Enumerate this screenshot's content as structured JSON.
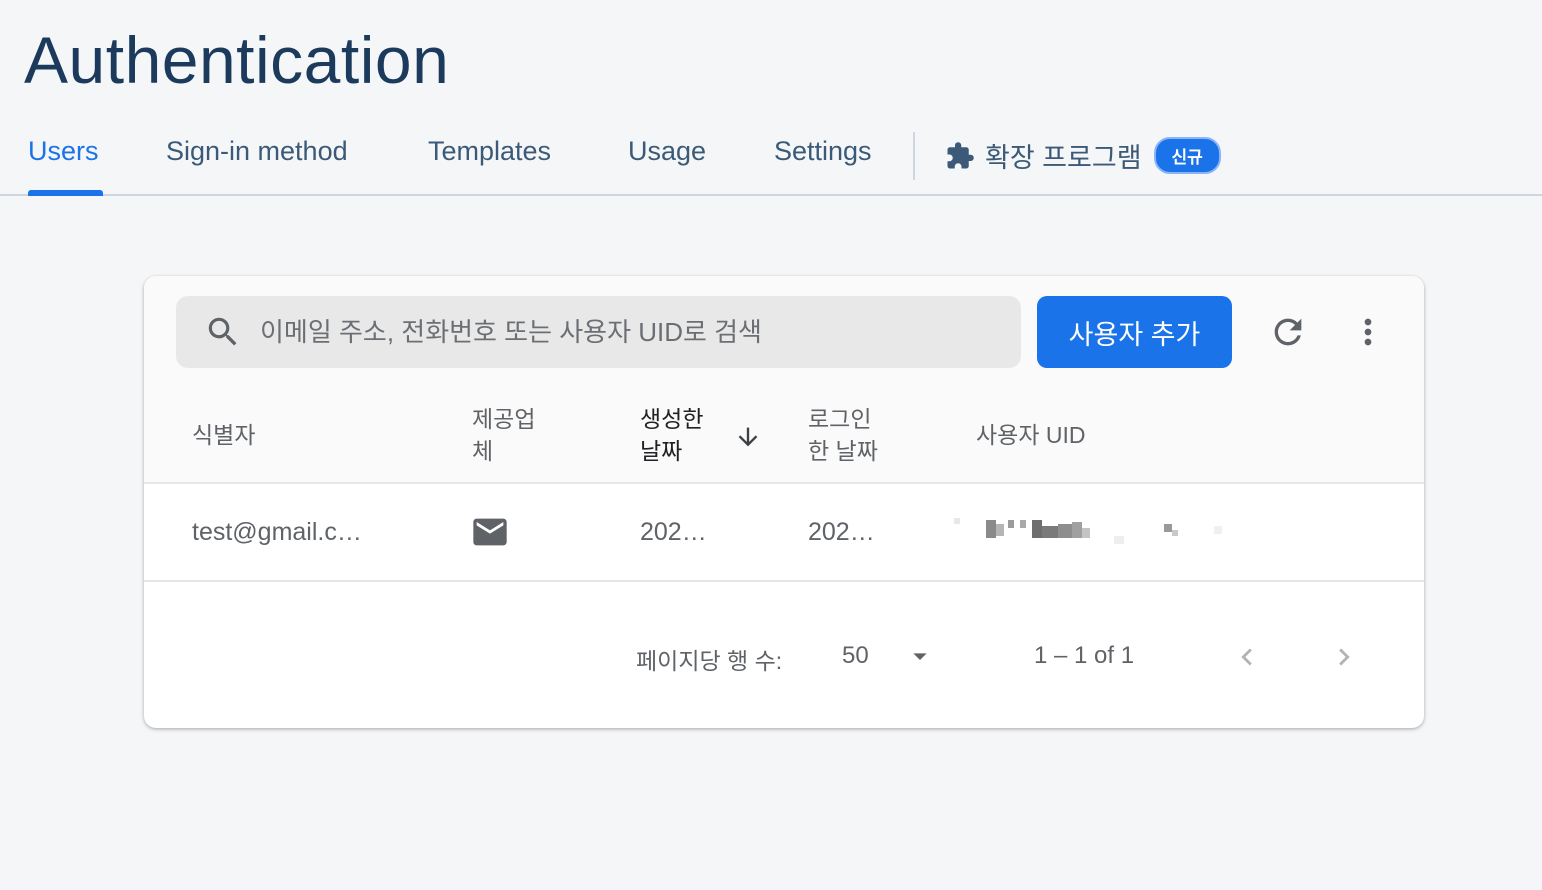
{
  "page": {
    "title": "Authentication"
  },
  "tabs": [
    {
      "label": "Users",
      "active": true
    },
    {
      "label": "Sign-in method",
      "active": false
    },
    {
      "label": "Templates",
      "active": false
    },
    {
      "label": "Usage",
      "active": false
    },
    {
      "label": "Settings",
      "active": false
    }
  ],
  "extensions_tab": {
    "icon": "puzzle-icon",
    "label": "확장 프로그램",
    "badge": "신규"
  },
  "toolbar": {
    "search_placeholder": "이메일 주소, 전화번호 또는 사용자 UID로 검색",
    "search_value": "",
    "add_user_label": "사용자 추가",
    "refresh_icon": "refresh-icon",
    "more_icon": "more-vert-icon"
  },
  "table": {
    "columns": {
      "identifier": "식별자",
      "provider_line1": "제공업",
      "provider_line2": "체",
      "created_line1": "생성한",
      "created_line2": "날짜",
      "signed_in_line1": "로그인",
      "signed_in_line2": "한 날짜",
      "uid": "사용자 UID"
    },
    "sort": {
      "column": "created",
      "direction": "descending",
      "icon": "arrow-down-icon"
    },
    "rows": [
      {
        "identifier": "test@gmail.c…",
        "provider_icon": "email-icon",
        "created": "202…",
        "signed_in": "202…",
        "uid_redacted": true
      }
    ]
  },
  "pagination": {
    "rows_per_page_label": "페이지당 행 수:",
    "rows_per_page": "50",
    "range": "1 – 1 of 1"
  },
  "colors": {
    "accent": "#1a73e8",
    "title": "#1b3a5c",
    "background": "#f5f6f8"
  }
}
